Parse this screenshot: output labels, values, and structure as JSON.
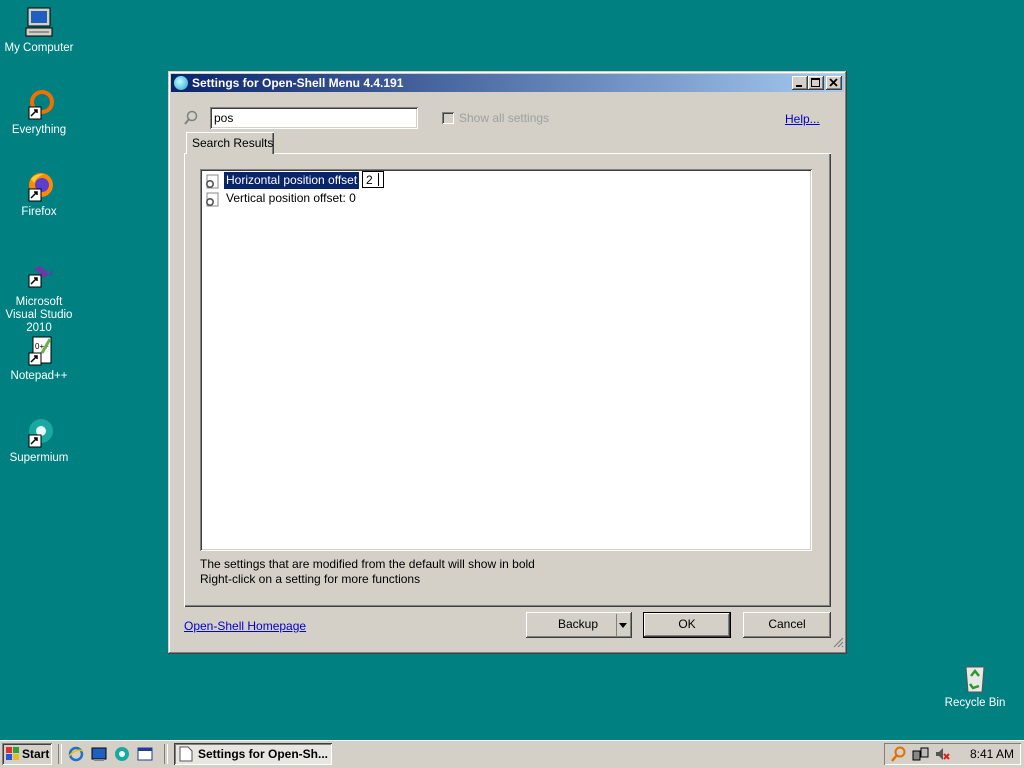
{
  "desktop": {
    "icons": [
      {
        "label": "My Computer",
        "icon": "computer-icon"
      },
      {
        "label": "Everything",
        "icon": "everything-icon"
      },
      {
        "label": "Firefox",
        "icon": "firefox-icon"
      },
      {
        "label": "Microsoft Visual Studio 2010",
        "icon": "visual-studio-icon"
      },
      {
        "label": "Notepad++",
        "icon": "notepad-plus-plus-icon"
      },
      {
        "label": "Supermium",
        "icon": "supermium-icon"
      },
      {
        "label": "Recycle Bin",
        "icon": "recycle-bin-icon"
      }
    ]
  },
  "window": {
    "title": "Settings for Open-Shell Menu 4.4.191",
    "search": {
      "value": "pos",
      "placeholder": ""
    },
    "show_all_label": "Show all settings",
    "show_all_checked": false,
    "help_label": "Help...",
    "tab_label": "Search Results",
    "settings": [
      {
        "label": "Horizontal position offset",
        "edit_value": "2",
        "selected": true
      },
      {
        "label": "Vertical position offset: 0",
        "selected": false
      }
    ],
    "hints": [
      "The settings that are modified from the default will show in bold",
      "Right-click on a setting for more functions"
    ],
    "homepage_label": "Open-Shell Homepage",
    "backup_label": "Backup",
    "ok_label": "OK",
    "cancel_label": "Cancel"
  },
  "taskbar": {
    "start_label": "Start",
    "task_label": "Settings for Open-Sh...",
    "clock": "8:41 AM"
  },
  "colors": {
    "desktop": "#008080",
    "titlebar_start": "#0a246a",
    "titlebar_end": "#a6caf0",
    "selection": "#0a246a"
  }
}
